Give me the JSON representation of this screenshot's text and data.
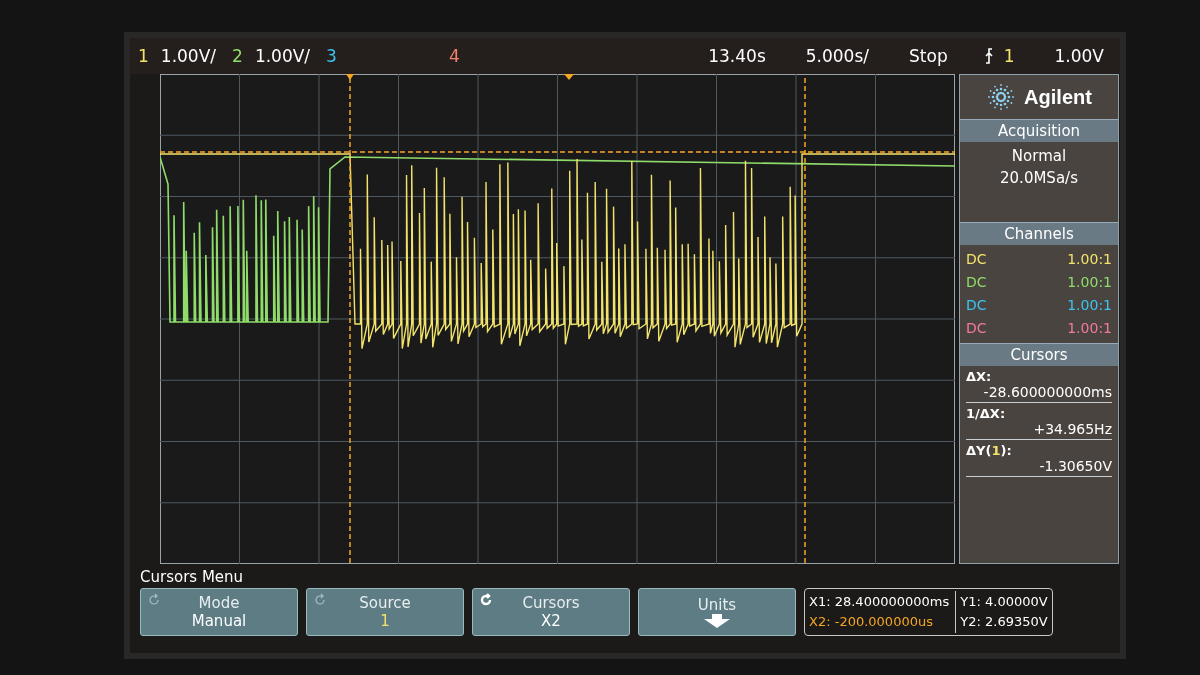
{
  "header": {
    "channels": [
      {
        "number": "1",
        "scale": "1.00V/",
        "color": "#f2e36a"
      },
      {
        "number": "2",
        "scale": "1.00V/",
        "color": "#8fdc6a"
      },
      {
        "number": "3",
        "color": "#3cc3f0"
      },
      {
        "number": "4",
        "color": "#f08070"
      }
    ],
    "delay": "13.40s",
    "timebase": "5.000s/",
    "run_state": "Stop",
    "trigger": {
      "source": "1",
      "level": "1.00V",
      "color": "#f2e36a"
    }
  },
  "sidebar": {
    "logo": "Agilent",
    "acquisition": {
      "title": "Acquisition",
      "mode": "Normal",
      "rate": "20.0MSa/s"
    },
    "channels": {
      "title": "Channels",
      "rows": [
        {
          "coupling": "DC",
          "probe": "1.00:1",
          "color": "#f2e36a"
        },
        {
          "coupling": "DC",
          "probe": "1.00:1",
          "color": "#8fdc6a"
        },
        {
          "coupling": "DC",
          "probe": "1.00:1",
          "color": "#3cc3f0"
        },
        {
          "coupling": "DC",
          "probe": "1.00:1",
          "color": "#f07a9a"
        }
      ]
    },
    "cursors": {
      "title": "Cursors",
      "readouts": [
        {
          "label": "ΔX:",
          "value": "-28.600000000ms"
        },
        {
          "label": "1/ΔX:",
          "value": "+34.965Hz"
        },
        {
          "label": "ΔY(",
          "channel": "1",
          "label_end": "):",
          "value": "-1.30650V"
        }
      ]
    }
  },
  "menu": {
    "title": "Cursors Menu",
    "softkeys": [
      {
        "kind": "value",
        "label": "Mode",
        "value": "Manual",
        "color": "#ffffff"
      },
      {
        "kind": "value",
        "label": "Source",
        "value": "1",
        "color": "#f2e36a"
      },
      {
        "kind": "value",
        "label": "Cursors",
        "value": "X2",
        "color": "#ffffff"
      },
      {
        "kind": "arrow",
        "label": "Units"
      }
    ],
    "x_readouts": [
      {
        "label": "X1:",
        "value": "28.400000000ms",
        "color": "#ffffff"
      },
      {
        "label": "X2:",
        "value": "-200.000000us",
        "color": "#f5a623"
      }
    ],
    "y_readouts": [
      {
        "label": "Y1:",
        "value": "4.00000V"
      },
      {
        "label": "Y2:",
        "value": "2.69350V"
      }
    ]
  }
}
